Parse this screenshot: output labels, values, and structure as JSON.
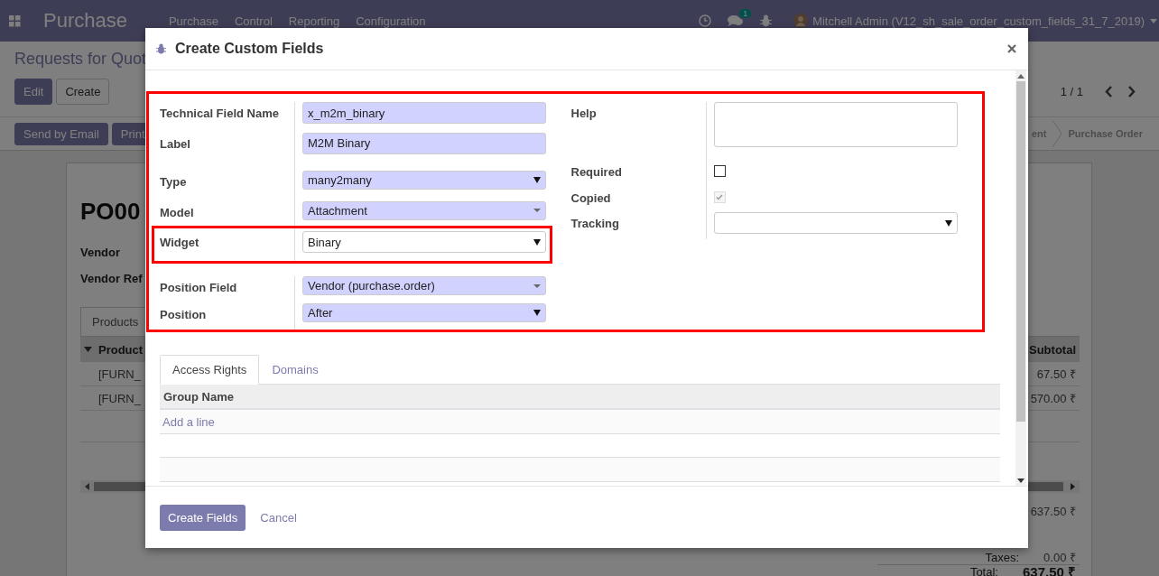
{
  "navbar": {
    "app": "Purchase",
    "menus": [
      "Purchase",
      "Control",
      "Reporting",
      "Configuration"
    ],
    "messages_badge": "1",
    "user": "Mitchell Admin (V12_sh_sale_order_custom_fields_31_7_2019)"
  },
  "control_panel": {
    "breadcrumb": "Requests for Quot",
    "buttons": [
      "Edit",
      "Create"
    ],
    "pager": "1 / 1"
  },
  "header": {
    "buttons": [
      "Send by Email",
      "Print"
    ],
    "stages": [
      "ent",
      "Purchase Order"
    ]
  },
  "sheet": {
    "title": "PO00",
    "fields": [
      "Vendor",
      "Vendor Ref"
    ],
    "tab": "Products",
    "columns": [
      "Product",
      "Subtotal"
    ],
    "rows": [
      {
        "product": "[FURN_",
        "subtotal": "67.50 ₹"
      },
      {
        "product": "[FURN_",
        "subtotal": "570.00 ₹"
      }
    ],
    "totals": [
      {
        "kind": "line",
        "value": "637.50 ₹"
      },
      {
        "kind": "line",
        "label": "Taxes:",
        "value": "0.00 ₹"
      },
      {
        "kind": "total",
        "label": "Total:",
        "value": "637.50 ₹"
      }
    ]
  },
  "dialog": {
    "title": "Create Custom Fields",
    "left_fields": [
      {
        "label": "Technical Field Name",
        "kind": "text",
        "value": "x_m2m_binary",
        "required": true,
        "highlighted": false
      },
      {
        "label": "Label",
        "kind": "text",
        "value": "M2M Binary",
        "required": true,
        "highlighted": false
      },
      {
        "label": "Type",
        "kind": "select",
        "value": "many2many",
        "required": true,
        "highlighted": false
      },
      {
        "label": "Model",
        "kind": "many2one",
        "value": "Attachment",
        "required": true,
        "highlighted": false
      },
      {
        "label": "Widget",
        "kind": "select",
        "value": "Binary",
        "required": false,
        "highlighted": true
      },
      {
        "label": "Position Field",
        "kind": "many2one",
        "value": "Vendor (purchase.order)",
        "required": true,
        "highlighted": false
      },
      {
        "label": "Position",
        "kind": "select",
        "value": "After",
        "required": true,
        "highlighted": false
      }
    ],
    "right_fields": [
      {
        "label": "Help",
        "kind": "textarea",
        "required": false
      },
      {
        "label": "Required",
        "kind": "checkbox",
        "checked": false,
        "disabled": false
      },
      {
        "label": "Copied",
        "kind": "checkbox",
        "checked": true,
        "disabled": true
      },
      {
        "label": "Tracking",
        "kind": "select",
        "required": false
      }
    ],
    "tabs": [
      {
        "label": "Access Rights",
        "selected": true
      },
      {
        "label": "Domains",
        "selected": false
      }
    ],
    "table": {
      "columns": [
        "Group Name"
      ],
      "add_line": "Add a line"
    },
    "buttons": {
      "primary": "Create Fields",
      "cancel": "Cancel"
    }
  }
}
